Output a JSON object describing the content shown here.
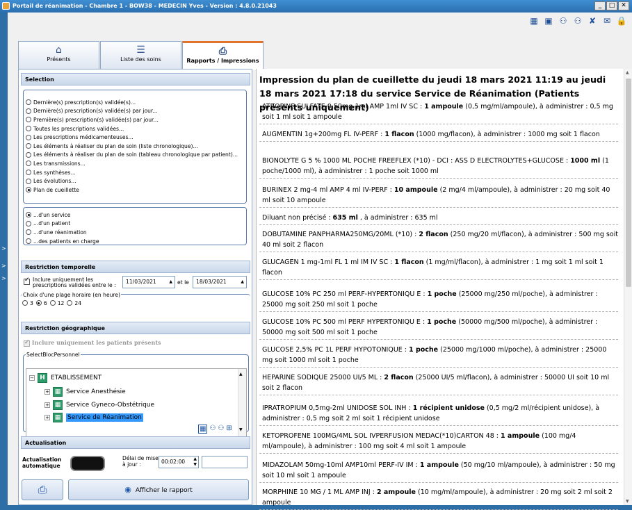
{
  "window": {
    "title": "Portail de réanimation - Chambre 1 - BOW38 - MEDECIN Yves - Version : 4.8.0.21043",
    "minimize": "_",
    "maximize": "□",
    "close": "✕"
  },
  "topicons": [
    {
      "name": "excel-icon",
      "glyph": "▦"
    },
    {
      "name": "id-card-icon",
      "glyph": "▣"
    },
    {
      "name": "user-link-icon",
      "glyph": "⚇"
    },
    {
      "name": "user-add-icon",
      "glyph": "⚇"
    },
    {
      "name": "user-remove-icon",
      "glyph": "✘"
    },
    {
      "name": "mail-icon",
      "glyph": "✉"
    },
    {
      "name": "lock-icon",
      "glyph": "🔒"
    }
  ],
  "tabs": [
    {
      "label": "Présents",
      "icon": "home-icon",
      "glyph": "⌂"
    },
    {
      "label": "Liste des soins",
      "icon": "list-icon",
      "glyph": "☰"
    },
    {
      "label": "Rapports / Impressions",
      "icon": "printer-icon",
      "glyph": "⎙"
    }
  ],
  "selection": {
    "title": "Selection",
    "options": [
      "Dernière(s) prescription(s) validée(s)...",
      "Dernière(s) prescription(s) validée(s) par jour...",
      "Première(s) prescription(s) validée(s) par jour...",
      "Toutes les prescriptions validées...",
      "Les prescriptions médicamenteuses...",
      "Les éléments à réaliser du plan de soin (liste chronologique)...",
      "Les éléments à réaliser du plan de soin (tableau chronologique par patient)...",
      "Les transmissions...",
      "Les synthèses...",
      "Les évolutions...",
      "Plan de cueillette"
    ],
    "selected_index": 10,
    "scope_options": [
      "...d'un service",
      "...d'un patient",
      "...d'une réanimation",
      "...des patients en charge"
    ],
    "scope_selected": 0
  },
  "temporal": {
    "title": "Restriction temporelle",
    "checkbox_label_1": "Inclure uniquement les",
    "checkbox_label_2": "prescriptions validées entre le :",
    "date_from": "11/03/2021",
    "and_label": "et le",
    "date_to": "18/03/2021",
    "range_label": "Choix d'une plage horaire (en heure)",
    "hours": [
      "3",
      "6",
      "12",
      "24"
    ],
    "hours_selected": 1
  },
  "geo": {
    "title": "Restriction géographique",
    "include_label": "Inclure uniquement les patients présents",
    "group_label": "SelectBlocPersonnel",
    "tree": [
      {
        "label": "ETABLISSEMENT",
        "level": 0
      },
      {
        "label": "Service Anesthésie",
        "level": 1
      },
      {
        "label": "Service Gyneco-Obstétrique",
        "level": 1
      },
      {
        "label": "Service de Réanimation",
        "level": 1
      }
    ]
  },
  "refresh": {
    "title": "Actualisation",
    "auto_label_1": "Actualisation",
    "auto_label_2": "automatique",
    "delay_label_1": "Délai de mise",
    "delay_label_2": "à jour :",
    "delay_value": "00:02:00"
  },
  "actions": {
    "print_glyph": "⎙",
    "report_label": "Afficher le rapport"
  },
  "report": {
    "heading": "Impression du plan de cueillette du jeudi 18 mars 2021 11:19 au jeudi 18 mars 2021 17:18 du service Service de Réanimation (Patients présents uniquement)",
    "items": [
      {
        "pre": "ATROPINE SULFATE 0,50mg-1ml AMP 1ml IV SC : ",
        "qty": "1 ampoule",
        "post": " (0,5 mg/ml/ampoule), à administrer : 0,5 mg soit 1 ml soit 1 ampoule"
      },
      {
        "pre": "AUGMENTIN 1g+200mg FL IV-PERF : ",
        "qty": "1 flacon",
        "post": " (1000 mg/flacon), à administrer : 1000 mg soit 1 flacon"
      },
      {
        "pre": "BIONOLYTE G 5 % 1000 ML POCHE FREEFLEX (*10) - DCI : ASS D ELECTROLYTES+GLUCOSE : ",
        "qty": "1000 ml",
        "post": " (1 poche/1000 ml), à administrer : 1 poche soit 1000 ml"
      },
      {
        "pre": "BURINEX 2 mg-4 ml AMP 4 ml IV-PERF : ",
        "qty": "10 ampoule",
        "post": " (2 mg/4 ml/ampoule), à administrer : 20 mg soit 40 ml soit 10 ampoule"
      },
      {
        "pre": "Diluant non précisé : ",
        "qty": "635 ml",
        "post": " , à administrer : 635 ml"
      },
      {
        "pre": "DOBUTAMINE PANPHARMA250MG/20ML (*10) : ",
        "qty": "2 flacon",
        "post": " (250 mg/20 ml/flacon), à administrer : 500 mg soit 40 ml soit 2 flacon"
      },
      {
        "pre": "GLUCAGEN 1 mg-1ml FL 1 ml IM IV SC : ",
        "qty": "1 flacon",
        "post": " (1 mg/ml/flacon), à administrer : 1 mg soit 1 ml soit 1 flacon"
      },
      {
        "pre": "GLUCOSE 10% PC 250 ml PERF-HYPERTONIQU E : ",
        "qty": "1 poche",
        "post": " (25000 mg/250 ml/poche), à administrer : 25000 mg soit 250 ml soit 1 poche"
      },
      {
        "pre": "GLUCOSE 10% PC 500 ml PERF HYPERTONIQU E : ",
        "qty": "1 poche",
        "post": " (50000 mg/500 ml/poche), à administrer : 50000 mg soit 500 ml soit 1 poche"
      },
      {
        "pre": "GLUCOSE 2,5% PC 1L PERF HYPOTONIQUE : ",
        "qty": "1 poche",
        "post": " (25000 mg/1000 ml/poche), à administrer : 25000 mg soit 1000 ml soit 1 poche"
      },
      {
        "pre": "HEPARINE SODIQUE 25000 UI/5 ML : ",
        "qty": "2 flacon",
        "post": " (25000 UI/5 ml/flacon), à administrer : 50000 UI soit 10 ml soit 2 flacon"
      },
      {
        "pre": "IPRATROPIUM 0,5mg-2ml UNIDOSE SOL INH : ",
        "qty": "1 récipient unidose",
        "post": " (0,5 mg/2 ml/récipient unidose), à administrer : 0,5 mg soit 2 ml soit 1 récipient unidose"
      },
      {
        "pre": "KETOPROFENE 100MG/4ML SOL IVPERFUSION MEDAC(*10)CARTON 48 : ",
        "qty": "1 ampoule",
        "post": " (100 mg/4 ml/ampoule), à administrer : 100 mg soit 4 ml soit 1 ampoule"
      },
      {
        "pre": "MIDAZOLAM 50mg-10ml AMP10ml PERF-IV IM : ",
        "qty": "1 ampoule",
        "post": " (50 mg/10 ml/ampoule), à administrer : 50 mg soit 10 ml soit 1 ampoule"
      },
      {
        "pre": "MORPHINE 10 MG / 1 ML AMP INJ : ",
        "qty": "2 ampoule",
        "post": " (10 mg/ml/ampoule), à administrer : 20 mg soit 2 ml soit 2 ampoule"
      }
    ]
  }
}
